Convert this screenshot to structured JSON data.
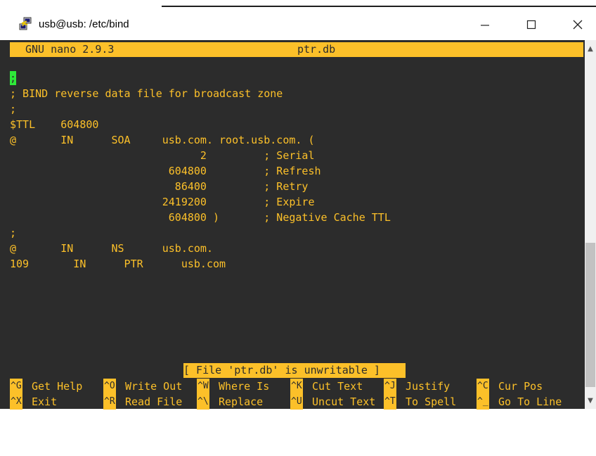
{
  "window": {
    "title": "usb@usb: /etc/bind",
    "icon": "putty-icon",
    "minimize": "—",
    "maximize": "☐",
    "close": "✕"
  },
  "nano": {
    "version": "GNU nano 2.9.3",
    "filename": "ptr.db",
    "cursor_char": ";",
    "lines": [
      "; BIND reverse data file for broadcast zone",
      ";",
      "$TTL    604800",
      "@       IN      SOA     usb.com. root.usb.com. (",
      "                              2         ; Serial",
      "                         604800         ; Refresh",
      "                          86400         ; Retry",
      "                        2419200         ; Expire",
      "                         604800 )       ; Negative Cache TTL",
      ";",
      "@       IN      NS      usb.com.",
      "109       IN      PTR      usb.com"
    ],
    "status": "[ File 'ptr.db' is unwritable ]",
    "shortcuts_row1": [
      {
        "key": "^G",
        "label": "Get Help"
      },
      {
        "key": "^O",
        "label": "Write Out"
      },
      {
        "key": "^W",
        "label": "Where Is"
      },
      {
        "key": "^K",
        "label": "Cut Text"
      },
      {
        "key": "^J",
        "label": "Justify"
      },
      {
        "key": "^C",
        "label": "Cur Pos"
      }
    ],
    "shortcuts_row2": [
      {
        "key": "^X",
        "label": "Exit"
      },
      {
        "key": "^R",
        "label": "Read File"
      },
      {
        "key": "^\\",
        "label": "Replace"
      },
      {
        "key": "^U",
        "label": "Uncut Text"
      },
      {
        "key": "^T",
        "label": "To Spell"
      },
      {
        "key": "^_",
        "label": "Go To Line"
      }
    ]
  },
  "colors": {
    "background": "#2c2c2c",
    "text": "#fcc029",
    "cursor": "#2ee839"
  }
}
